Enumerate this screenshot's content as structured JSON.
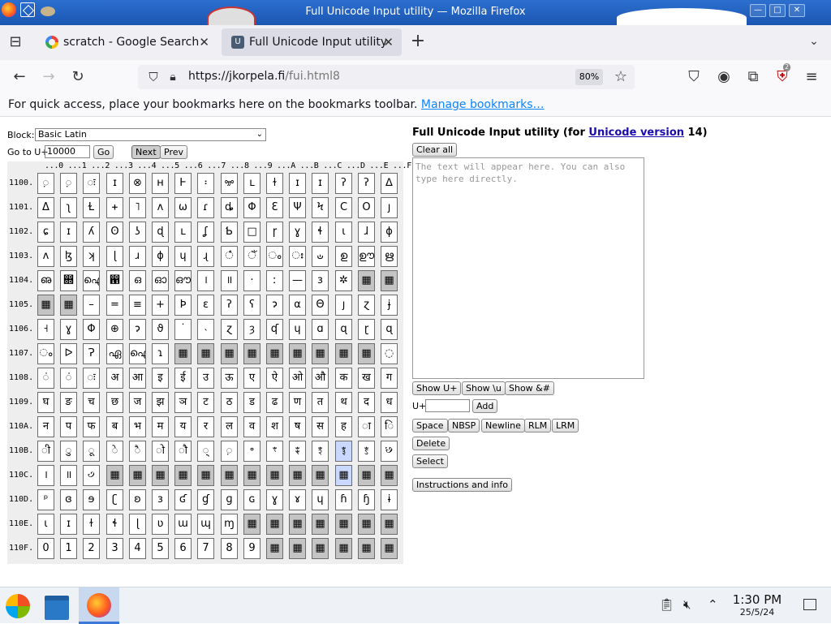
{
  "window": {
    "title": "Full Unicode Input utility — Mozilla Firefox",
    "min": "—",
    "max": "□",
    "close": "✕"
  },
  "tabs": [
    {
      "label": "scratch - Google Search"
    },
    {
      "label": "Full Unicode Input utility",
      "favicon": "U"
    }
  ],
  "nav": {
    "url_host": "https://jkorpela.fi",
    "url_path": "/fui.html8",
    "zoom": "80%",
    "ext_badge": "2"
  },
  "bookmarks_bar": {
    "text": "For quick access, place your bookmarks here on the bookmarks toolbar. ",
    "link": "Manage bookmarks…"
  },
  "left": {
    "block_label": "Block:",
    "block_value": "Basic Latin",
    "goto_label": "Go to U+",
    "goto_value": "10000",
    "go_btn": "Go",
    "next_btn": "Next",
    "prev_btn": "Prev",
    "col_header": "...0 ...1 ...2 ...3 ...4 ...5 ...6 ...7 ...8 ...9 ...A ...B ...C ...D ...E ...F",
    "rows": [
      {
        "label": "1100.",
        "cells": [
          "़",
          "़",
          "ः",
          "ɪ",
          "⊗",
          "ʜ",
          "Ͱ",
          "፡",
          "ꗁ",
          "ʟ",
          "ɫ",
          "ɪ",
          "ɪ",
          "ʔ",
          "ʔ",
          "ᐃ"
        ]
      },
      {
        "label": "1101.",
        "cells": [
          "Δ",
          "ʅ",
          "Ɫ",
          "ᚐ",
          "˥",
          "ʌ",
          "ω",
          "ɾ",
          "ȡ",
          "Φ",
          "Ɛ",
          "Ψ",
          "Ϟ",
          "Ϲ",
          "Ο",
          "ȷ"
        ]
      },
      {
        "label": "1102.",
        "cells": [
          "ɕ",
          "ɪ",
          "ʎ",
          "ʘ",
          "ʖ",
          "ɖ",
          "ʟ",
          "ʆ",
          "Ƅ",
          "□",
          "ɼ",
          "ɣ",
          "ɬ",
          "ɩ",
          "ɺ",
          "ɸ"
        ]
      },
      {
        "label": "1103.",
        "cells": [
          "ʌ",
          "ɮ",
          "ʞ",
          "ɭ",
          "ɹ",
          "ɸ",
          "ɥ",
          "ɻ",
          "ഀ",
          "ഁ",
          "ം",
          "ഃ",
          "ഄ",
          "ഉ",
          "ഊ",
          "ഋ"
        ]
      },
      {
        "label": "1104.",
        "cells": [
          "ഌ",
          "഍",
          "ഐ",
          "഑",
          "ഒ",
          "ഓ",
          "ഔ",
          "।",
          "॥",
          "·",
          "ː",
          "—",
          "ɜ",
          "✲",
          "▦",
          "▦"
        ]
      },
      {
        "label": "1105.",
        "cells": [
          "▦",
          "▦",
          "–",
          "=",
          "≡",
          "+",
          "Ϸ",
          "ɛ",
          "ʔ",
          "ʕ",
          "ɂ",
          "α",
          "Θ",
          "ȷ",
          "ɀ",
          "ɉ"
        ]
      },
      {
        "label": "1106.",
        "cells": [
          "˧",
          "ɣ",
          "Φ",
          "⊕",
          "ɂ",
          "ϑ",
          "˙",
          "˴",
          "ɀ",
          "ȝ",
          "ʠ",
          "ɥ",
          "ɑ",
          "ɋ",
          "ɽ",
          "ɋ"
        ]
      },
      {
        "label": "1107.",
        "cells": [
          "ം",
          "ᐅ",
          "Ɂ",
          "ഏ",
          "ഐ",
          "ɿ",
          "▦",
          "▦",
          "▦",
          "▦",
          "▦",
          "▦",
          "▦",
          "▦",
          "▦",
          "◌"
        ]
      },
      {
        "label": "1108.",
        "cells": [
          "ं",
          "ं",
          "ः",
          "अ",
          "आ",
          "इ",
          "ई",
          "उ",
          "ऊ",
          "ए",
          "ऐ",
          "ओ",
          "औ",
          "क",
          "ख",
          "ग"
        ]
      },
      {
        "label": "1109.",
        "cells": [
          "घ",
          "ङ",
          "च",
          "छ",
          "ज",
          "झ",
          "ञ",
          "ट",
          "ठ",
          "ड",
          "ढ",
          "ण",
          "त",
          "थ",
          "द",
          "ध"
        ]
      },
      {
        "label": "110A.",
        "cells": [
          "न",
          "प",
          "फ",
          "ब",
          "भ",
          "म",
          "य",
          "र",
          "ल",
          "व",
          "श",
          "ष",
          "स",
          "ह",
          "ा",
          "ि"
        ]
      },
      {
        "label": "110B.",
        "cells": [
          "ी",
          "ु",
          "ू",
          "े",
          "ै",
          "ो",
          "ौ",
          "्",
          "़",
          "॰",
          "ꣳ",
          "ꣴ",
          "ꣵ",
          "ꣶ",
          "ꣷ",
          "꣸"
        ]
      },
      {
        "label": "110C.",
        "cells": [
          "।",
          "॥",
          "꣹",
          "▦",
          "▦",
          "▦",
          "▦",
          "▦",
          "▦",
          "▦",
          "▦",
          "▦",
          "▦",
          "▦",
          "▦",
          "▦"
        ]
      },
      {
        "label": "110D.",
        "cells": [
          "ᵖ",
          "ɞ",
          "ɘ",
          "ʗ",
          "ʚ",
          "ɜ",
          "ʛ",
          "ɠ",
          "ɡ",
          "ɢ",
          "ɣ",
          "ɤ",
          "ɥ",
          "ɦ",
          "ɧ",
          "ɨ"
        ]
      },
      {
        "label": "110E.",
        "cells": [
          "ɩ",
          "ɪ",
          "ɫ",
          "ɬ",
          "ɭ",
          "ʋ",
          "ɯ",
          "ɰ",
          "ɱ",
          "▦",
          "▦",
          "▦",
          "▦",
          "▦",
          "▦",
          "▦"
        ]
      },
      {
        "label": "110F.",
        "cells": [
          "0",
          "1",
          "2",
          "3",
          "4",
          "5",
          "6",
          "7",
          "8",
          "9",
          "▦",
          "▦",
          "▦",
          "▦",
          "▦",
          "▦"
        ]
      }
    ]
  },
  "right": {
    "title_prefix": "Full Unicode Input utility (for ",
    "title_link": "Unicode version",
    "title_suffix": " 14)",
    "clear_all": "Clear all",
    "output_placeholder": "The text will appear here. You can also type here directly.",
    "show_u": "Show U+",
    "show_backslash": "Show \\u",
    "show_amp": "Show &#",
    "u_label": "U+",
    "add": "Add",
    "space": "Space",
    "nbsp": "NBSP",
    "newline": "Newline",
    "rlm": "RLM",
    "lrm": "LRM",
    "delete": "Delete",
    "select": "Select",
    "instructions": "Instructions and info"
  },
  "taskbar": {
    "time": "1:30 PM",
    "date": "25/5/24"
  },
  "colors": {
    "titlebar": "#1b56b3",
    "link": "#0a84ff",
    "cell_dark": "#c4c4c4",
    "cell_highlight": "#c8d8ff"
  }
}
